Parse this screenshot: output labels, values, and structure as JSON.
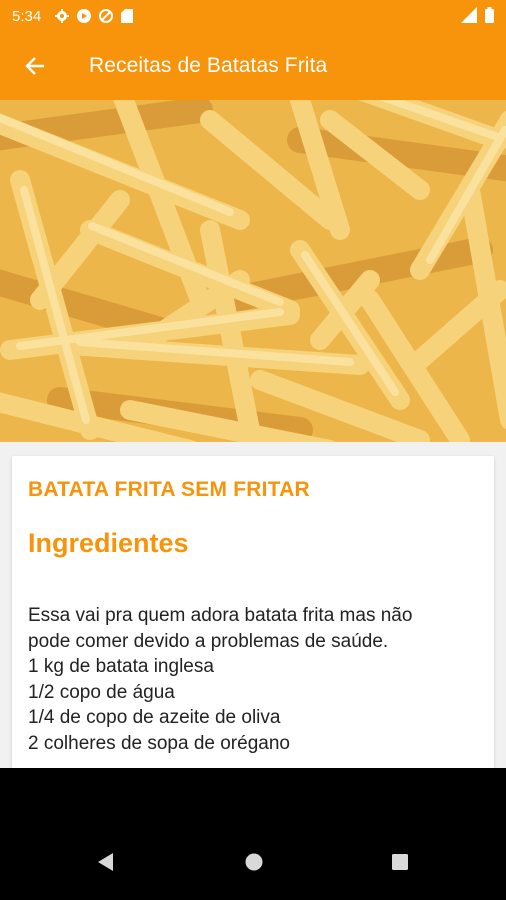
{
  "status_bar": {
    "time": "5:34",
    "left_icons": [
      "settings-icon",
      "play-store-icon",
      "data-saver-icon",
      "sd-card-icon"
    ],
    "right_icons": [
      "signal-icon",
      "battery-icon"
    ]
  },
  "app_bar": {
    "title": "Receitas de Batatas Frita",
    "back_icon": "arrow-left-icon"
  },
  "hero": {
    "subject": "french-fries-photo"
  },
  "recipe": {
    "title": "BATATA FRITA SEM FRITAR",
    "section": "Ingredientes",
    "lines": [
      "Essa vai pra quem adora batata frita mas não",
      "pode comer devido a problemas de saúde.",
      "1 kg de batata inglesa",
      "1/2 copo de água",
      "1/4 de copo de azeite de oliva",
      "2 colheres de sopa de orégano"
    ]
  },
  "nav_bar": {
    "buttons": [
      "back-triangle-icon",
      "home-circle-icon",
      "recents-square-icon"
    ]
  },
  "colors": {
    "primary": "#f7940b",
    "text": "#222222",
    "background": "#f1f1f1"
  }
}
